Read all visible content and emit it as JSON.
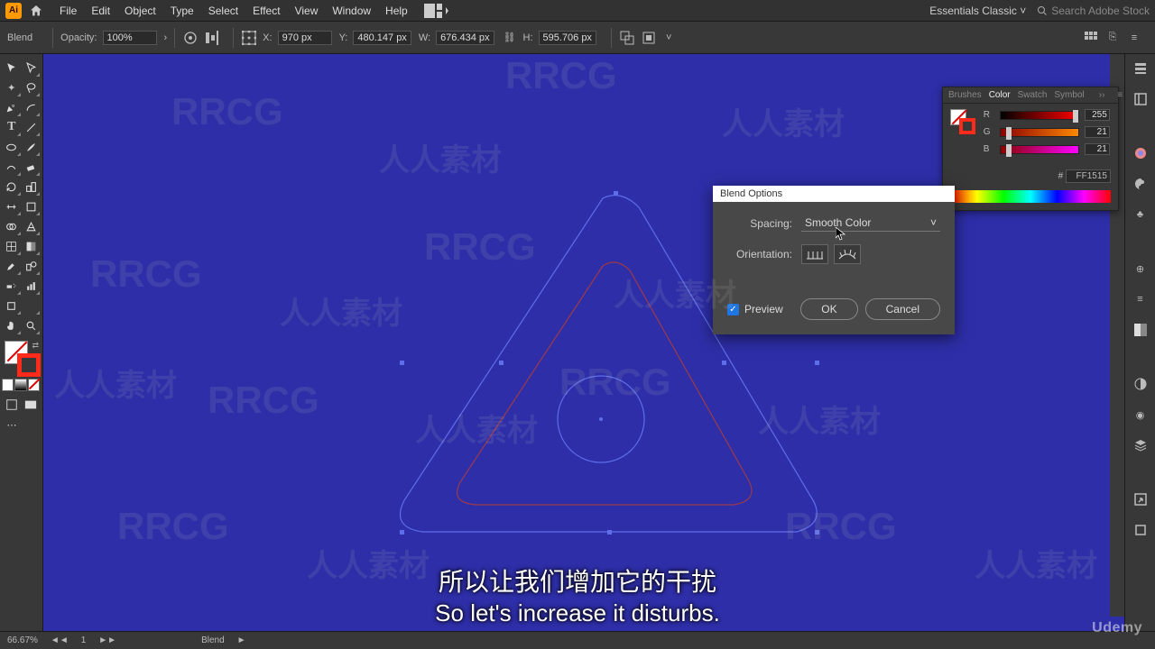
{
  "menubar": {
    "app_abbr": "Ai",
    "items": [
      "File",
      "Edit",
      "Object",
      "Type",
      "Select",
      "Effect",
      "View",
      "Window",
      "Help"
    ],
    "workspace": "Essentials Classic",
    "search_placeholder": "Search Adobe Stock"
  },
  "controlbar": {
    "selection_label": "Blend",
    "opacity_label": "Opacity:",
    "opacity_value": "100%",
    "x_label": "X:",
    "x_value": "970 px",
    "y_label": "Y:",
    "y_value": "480.147 px",
    "w_label": "W:",
    "w_value": "676.434 px",
    "h_label": "H:",
    "h_value": "595.706 px"
  },
  "color_panel": {
    "tabs": [
      "Brushes",
      "Color",
      "Swatch",
      "Symbol"
    ],
    "active_tab": "Color",
    "r_label": "R",
    "r_value": "255",
    "g_label": "G",
    "g_value": "21",
    "b_label": "B",
    "b_value": "21",
    "hex_label": "#",
    "hex_value": "FF1515"
  },
  "dialog": {
    "title": "Blend Options",
    "spacing_label": "Spacing:",
    "spacing_value": "Smooth Color",
    "orientation_label": "Orientation:",
    "preview_label": "Preview",
    "ok": "OK",
    "cancel": "Cancel"
  },
  "statusbar": {
    "zoom": "66.67%",
    "artboard_nav": "1",
    "tool": "Blend"
  },
  "subtitles": {
    "cn": "所以让我们增加它的干扰",
    "en": "So let's increase it disturbs."
  },
  "udemy": "Udemy",
  "watermark_en": "RRCG",
  "watermark_cn": "人人素材"
}
